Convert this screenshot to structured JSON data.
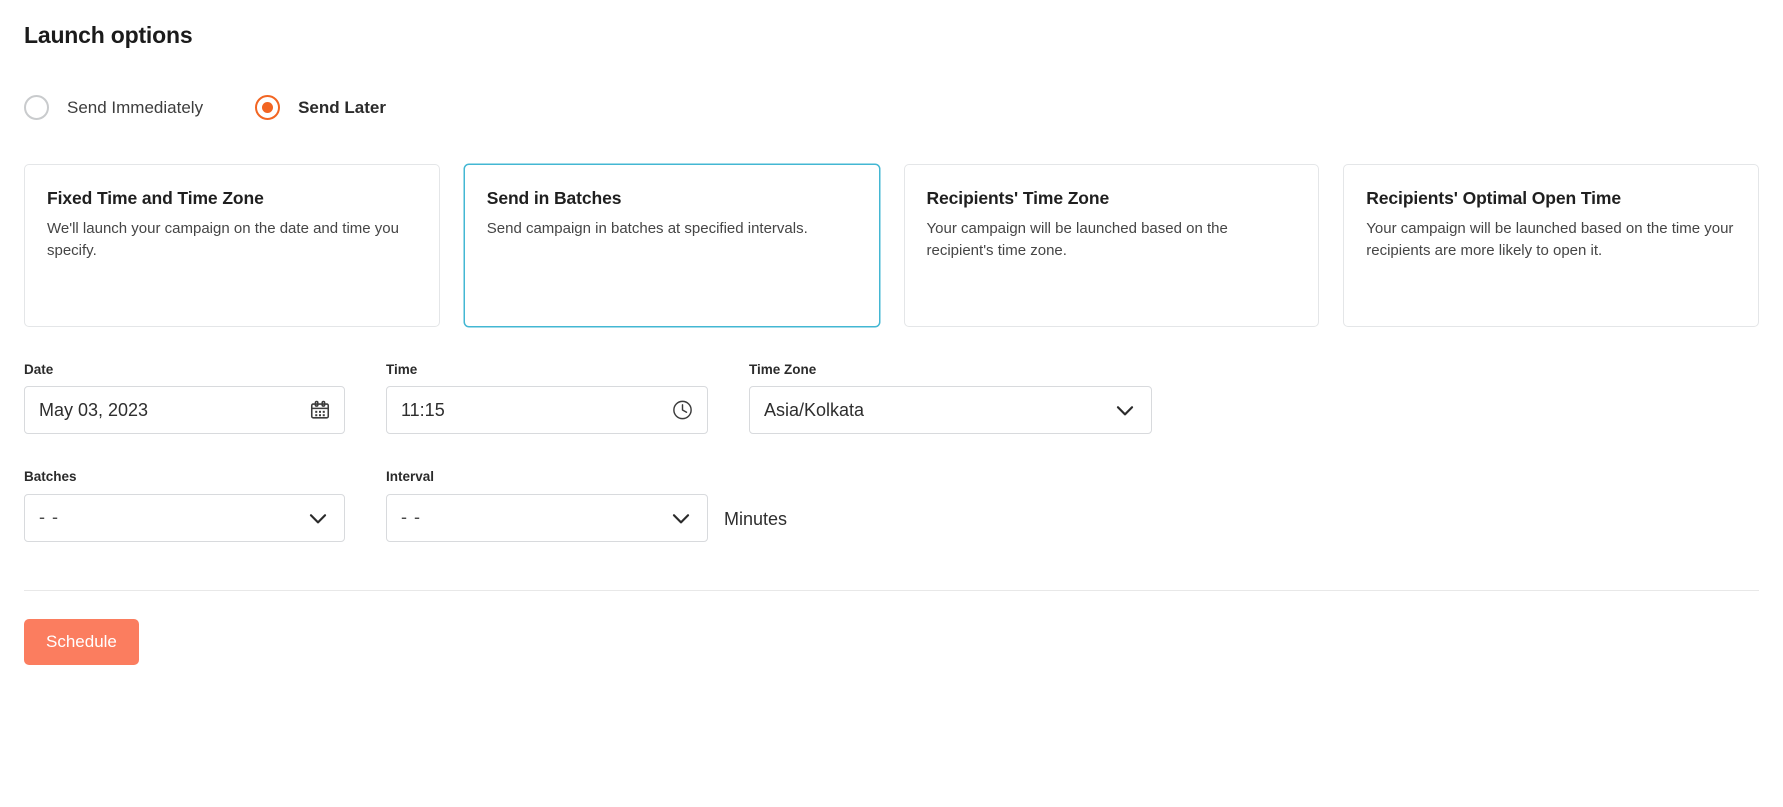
{
  "page": {
    "title": "Launch options"
  },
  "launch_mode": {
    "options": [
      {
        "label": "Send Immediately",
        "selected": false
      },
      {
        "label": "Send Later",
        "selected": true
      }
    ],
    "selected_color": "#f26522"
  },
  "schedule_cards": [
    {
      "title": "Fixed Time and Time Zone",
      "description": "We'll launch your campaign on the date and time you specify.",
      "selected": false
    },
    {
      "title": "Send in Batches",
      "description": "Send campaign in batches at specified intervals.",
      "selected": true
    },
    {
      "title": "Recipients' Time Zone",
      "description": "Your campaign will be launched based on the recipient's time zone.",
      "selected": false
    },
    {
      "title": "Recipients' Optimal Open Time",
      "description": "Your campaign will be launched based on the time your recipients are more likely to open it.",
      "selected": false
    }
  ],
  "selected_card_border_color": "#43b7d3",
  "form": {
    "date": {
      "label": "Date",
      "value": "May 03, 2023",
      "icon": "calendar-icon"
    },
    "time": {
      "label": "Time",
      "value": "11:15",
      "icon": "clock-icon"
    },
    "timezone": {
      "label": "Time Zone",
      "value": "Asia/Kolkata",
      "icon": "chevron-down-icon"
    },
    "batches": {
      "label": "Batches",
      "value": "- -",
      "icon": "chevron-down-icon"
    },
    "interval": {
      "label": "Interval",
      "value": "- -",
      "icon": "chevron-down-icon",
      "unit": "Minutes"
    }
  },
  "footer": {
    "submit_label": "Schedule",
    "submit_color": "#fb7d5f"
  }
}
